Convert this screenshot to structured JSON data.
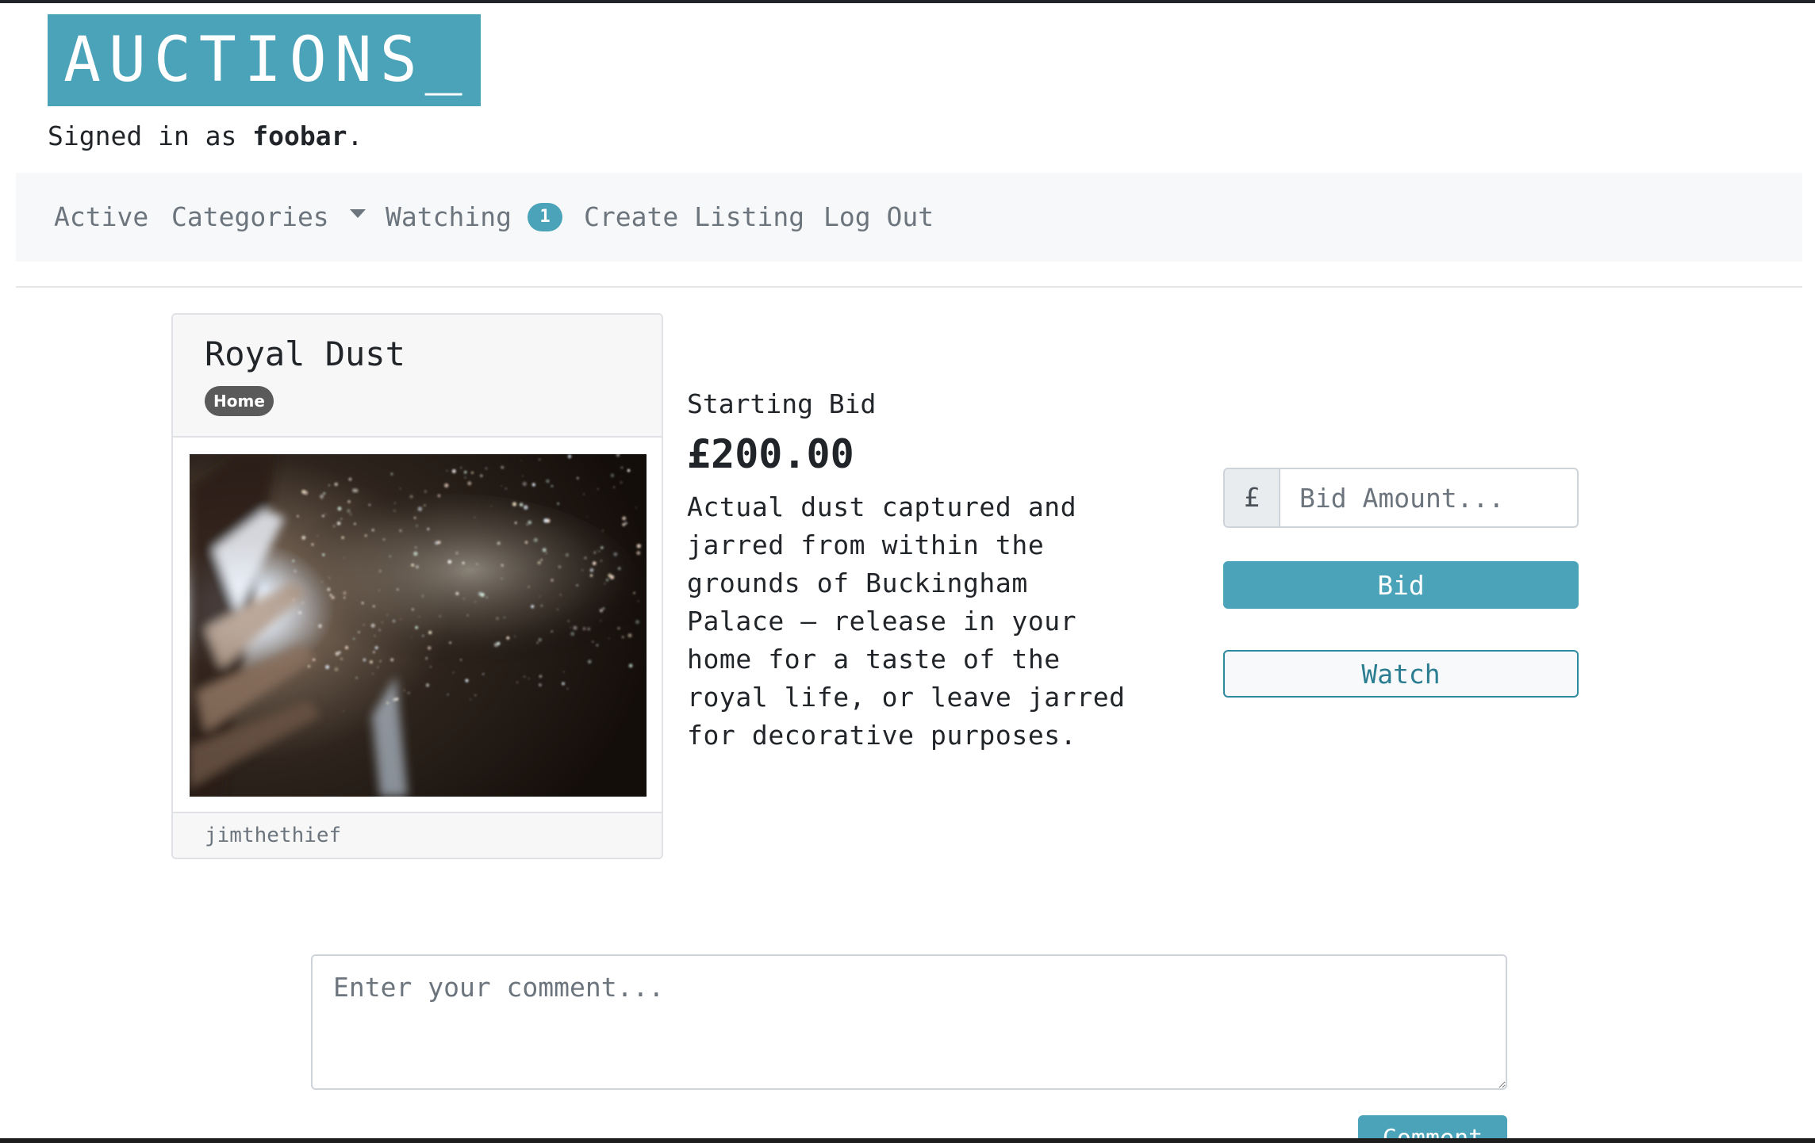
{
  "brand": {
    "title": "AUCTIONS_"
  },
  "user": {
    "signed_in_prefix": "Signed in as ",
    "username": "foobar",
    "suffix": "."
  },
  "nav": {
    "active": "Active",
    "categories": "Categories",
    "watching": "Watching",
    "watching_count": "1",
    "create_listing": "Create Listing",
    "log_out": "Log Out"
  },
  "listing": {
    "title": "Royal Dust",
    "category": "Home",
    "seller": "jimthethief",
    "image_alt": "Sparkling dust particles in a beam of light",
    "starting_bid_label": "Starting Bid",
    "price": "£200.00",
    "description": "Actual dust captured and jarred from within the grounds of Buckingham Palace – release in your home for a taste of the royal life, or leave jarred for decorative purposes."
  },
  "bid": {
    "currency_symbol": "£",
    "placeholder": "Bid Amount...",
    "bid_label": "Bid",
    "watch_label": "Watch"
  },
  "comment": {
    "placeholder": "Enter your comment...",
    "submit_label": "Comment"
  },
  "colors": {
    "accent": "#4aa3b8",
    "badge": "#5a5a5a"
  }
}
